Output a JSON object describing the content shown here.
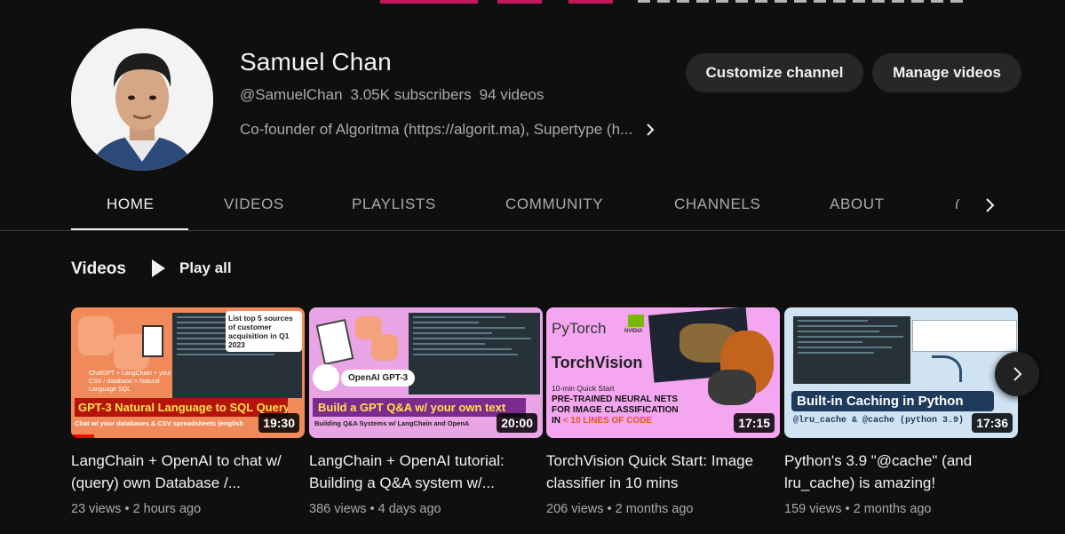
{
  "channel": {
    "name": "Samuel Chan",
    "handle": "@SamuelChan",
    "subscribers": "3.05K subscribers",
    "videos_count": "94 videos",
    "description": "Co-founder of Algoritma (https://algorit.ma), Supertype (h..."
  },
  "buttons": {
    "customize": "Customize channel",
    "manage": "Manage videos"
  },
  "tabs": [
    {
      "label": "HOME",
      "active": true
    },
    {
      "label": "VIDEOS",
      "active": false
    },
    {
      "label": "PLAYLISTS",
      "active": false
    },
    {
      "label": "COMMUNITY",
      "active": false
    },
    {
      "label": "CHANNELS",
      "active": false
    },
    {
      "label": "ABOUT",
      "active": false
    }
  ],
  "section": {
    "title": "Videos",
    "play_all": "Play all"
  },
  "videos": [
    {
      "title": "LangChain + OpenAI to chat w/ (query) own Database /...",
      "views": "23 views",
      "age": "2 hours ago",
      "duration": "19:30",
      "watched_fraction": 0.1,
      "thumb_text": {
        "bubble": "List top 5 sources of customer acquisition in Q1 2023",
        "flow": "ChatGPT + LangChain + your CSV / database = Natural Language SQL",
        "banner": "GPT-3 Natural Language to SQL Query",
        "sub": "Chat w/ your databases & CSV spreadsheets (english"
      }
    },
    {
      "title": "LangChain + OpenAI tutorial: Building a Q&A system w/...",
      "views": "386 views",
      "age": "4 days ago",
      "duration": "20:00",
      "watched_fraction": 0,
      "thumb_text": {
        "badge": "OpenAI GPT-3",
        "banner": "Build a GPT Q&A w/ your own text",
        "sub": "Building Q&A Systems w/ LangChain and OpenA"
      }
    },
    {
      "title": "TorchVision Quick Start: Image classifier in 10 mins",
      "views": "206 views",
      "age": "2 months ago",
      "duration": "17:15",
      "watched_fraction": 0,
      "thumb_text": {
        "brand": "PyTorch",
        "nvidia": "NVIDIA",
        "title": "TorchVision",
        "quick": "10-min Quick Start",
        "line1": "PRE-TRAINED NEURAL NETS",
        "line2": "FOR IMAGE CLASSIFICATION",
        "line3_prefix": "IN",
        "line3_hl": "< 10 LINES OF CODE"
      }
    },
    {
      "title": "Python's 3.9 \"@cache\" (and lru_cache) is amazing!",
      "views": "159 views",
      "age": "2 months ago",
      "duration": "17:36",
      "watched_fraction": 0,
      "thumb_text": {
        "banner": "Built-in Caching in Python",
        "sub": "@lru_cache & @cache (python 3.9)"
      }
    }
  ],
  "colors": {
    "background": "#0f0f0f",
    "button_bg": "#272727",
    "secondary_text": "#aaaaaa",
    "progress": "#ff0000"
  }
}
